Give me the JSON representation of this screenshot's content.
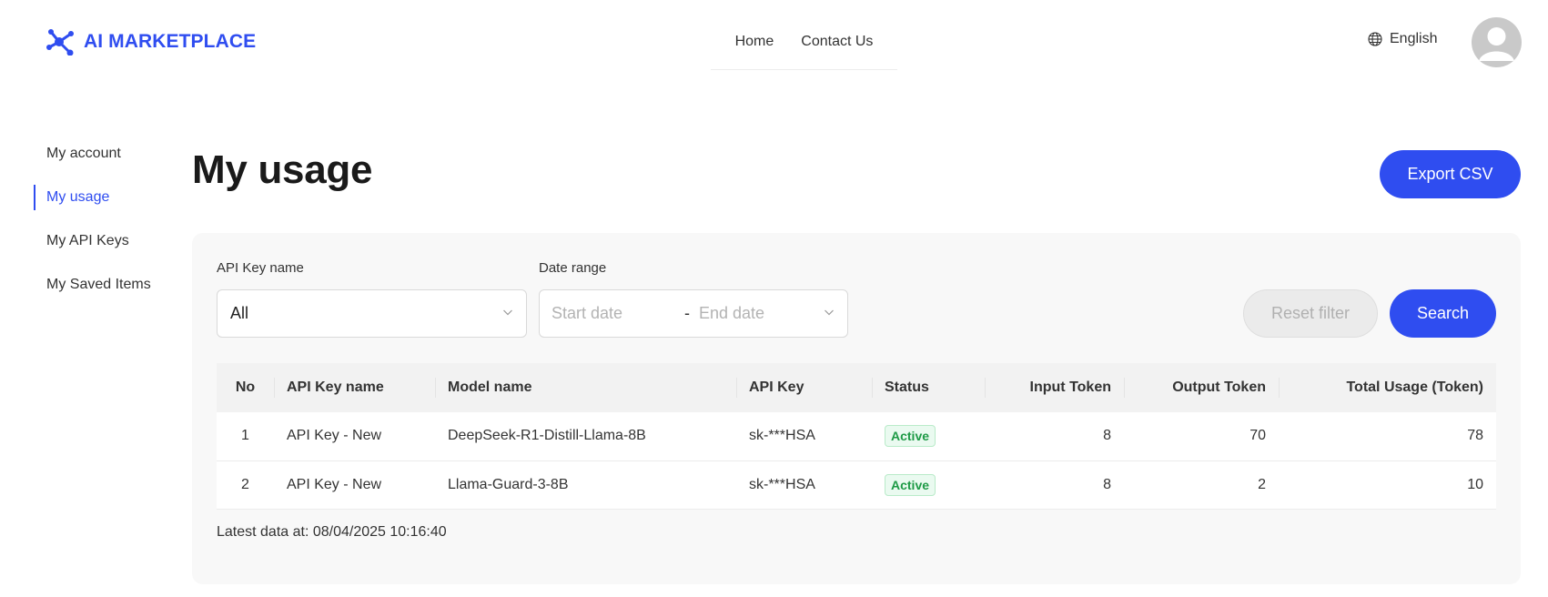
{
  "header": {
    "logo_text": "AI MARKETPLACE",
    "nav": [
      "Home",
      "Contact Us"
    ],
    "language": "English",
    "brand_color": "#2f4df0"
  },
  "sidebar": {
    "items": [
      {
        "label": "My account",
        "active": false
      },
      {
        "label": "My usage",
        "active": true
      },
      {
        "label": "My API Keys",
        "active": false
      },
      {
        "label": "My Saved Items",
        "active": false
      }
    ]
  },
  "main": {
    "title": "My usage",
    "export_label": "Export CSV"
  },
  "filters": {
    "api_key_label": "API Key name",
    "api_key_value": "All",
    "date_label": "Date range",
    "start_placeholder": "Start date",
    "separator": "-",
    "end_placeholder": "End date",
    "reset_label": "Reset filter",
    "search_label": "Search"
  },
  "table": {
    "headers": [
      "No",
      "API Key name",
      "Model name",
      "API Key",
      "Status",
      "Input Token",
      "Output Token",
      "Total Usage (Token)"
    ],
    "rows": [
      {
        "no": "1",
        "key_name": "API Key - New",
        "model": "DeepSeek-R1-Distill-Llama-8B",
        "api_key": "sk-***HSA",
        "status": "Active",
        "input": "8",
        "output": "70",
        "total": "78"
      },
      {
        "no": "2",
        "key_name": "API Key - New",
        "model": "Llama-Guard-3-8B",
        "api_key": "sk-***HSA",
        "status": "Active",
        "input": "8",
        "output": "2",
        "total": "10"
      }
    ]
  },
  "latest_data": "Latest data at: 08/04/2025 10:16:40"
}
